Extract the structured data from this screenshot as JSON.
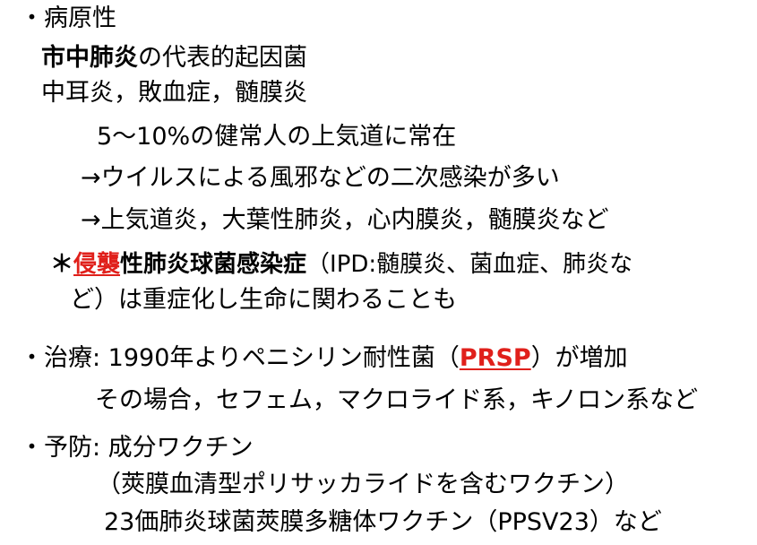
{
  "colors": {
    "text": "#000000",
    "accent": "#e0201b",
    "background": "#ffffff"
  },
  "pathogenicity": {
    "heading": "・病原性",
    "line1_bold": "市中肺炎",
    "line1_rest": "の代表的起因菌",
    "line2": "中耳炎，敗血症，髄膜炎",
    "line3": "5～10%の健常人の上気道に常在",
    "line4": "→ウイルスによる風邪などの二次感染が多い",
    "line5": "→上気道炎，大葉性肺炎，心内膜炎，髄膜炎など",
    "line6_star": "＊",
    "line6_red": "侵襲",
    "line6_bold": "性肺炎球菌感染症",
    "line6_rest": "（IPD:髄膜炎、菌血症、肺炎な",
    "line7": "ど）は重症化し生命に関わることも"
  },
  "treatment": {
    "heading_pre": "・治療: 1990年よりペニシリン耐性菌（",
    "heading_red": "PRSP",
    "heading_post": "）が増加",
    "line2": "その場合，セフェム，マクロライド系，キノロン系など"
  },
  "prevention": {
    "heading": "・予防: 成分ワクチン",
    "line2": "（莢膜血清型ポリサッカライドを含むワクチン）",
    "line3": "23価肺炎球菌莢膜多糖体ワクチン（PPSV23）など"
  }
}
